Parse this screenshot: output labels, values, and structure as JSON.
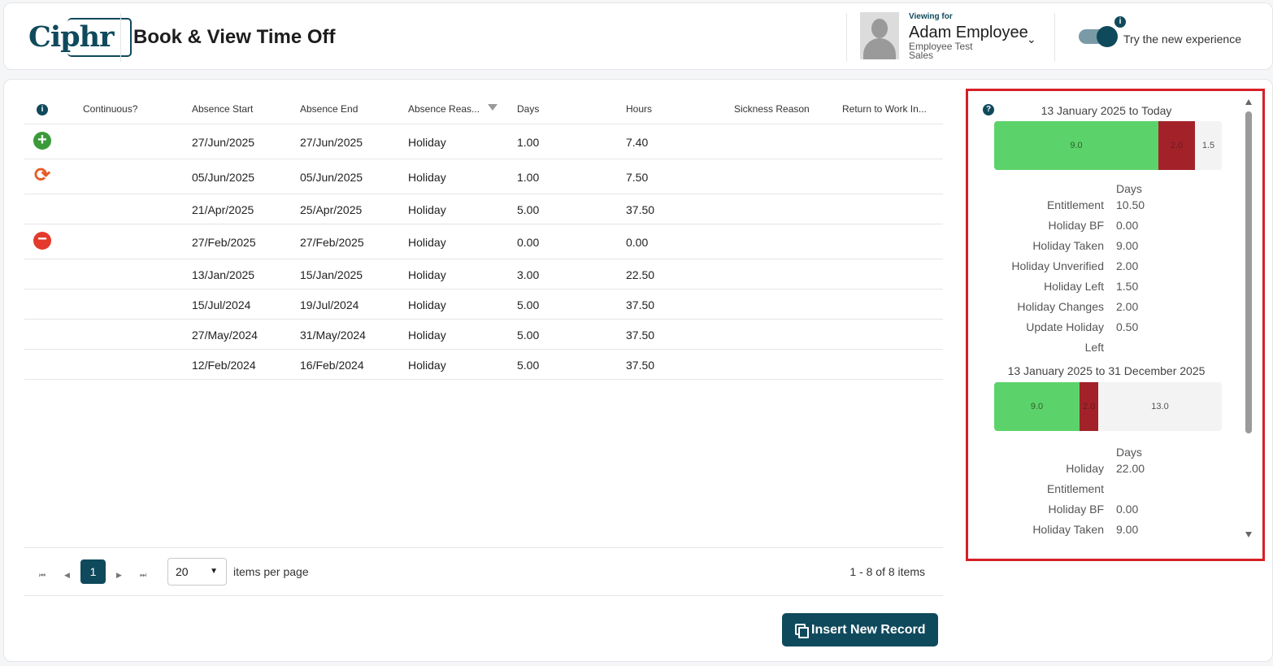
{
  "header": {
    "logo_text": "Ciphr",
    "page_title": "Book & View Time Off",
    "viewing_label": "Viewing for",
    "employee_name": "Adam Employee",
    "employee_sub1": "Employee Test",
    "employee_sub2": "Sales",
    "toggle_label": "Try the new experience",
    "toggle_on": true
  },
  "table": {
    "columns": [
      "Continuous?",
      "Absence Start",
      "Absence End",
      "Absence Reas...",
      "Days",
      "Hours",
      "Sickness Reason",
      "Return to Work In..."
    ],
    "rows": [
      {
        "status_icon": "add-circle-icon",
        "continuous": "",
        "start": "27/Jun/2025",
        "end": "27/Jun/2025",
        "reason": "Holiday",
        "days": "1.00",
        "hours": "7.40",
        "sickness": "",
        "rtw": ""
      },
      {
        "status_icon": "sync-icon",
        "continuous": "",
        "start": "05/Jun/2025",
        "end": "05/Jun/2025",
        "reason": "Holiday",
        "days": "1.00",
        "hours": "7.50",
        "sickness": "",
        "rtw": ""
      },
      {
        "status_icon": "",
        "continuous": "",
        "start": "21/Apr/2025",
        "end": "25/Apr/2025",
        "reason": "Holiday",
        "days": "5.00",
        "hours": "37.50",
        "sickness": "",
        "rtw": ""
      },
      {
        "status_icon": "remove-circle-icon",
        "continuous": "",
        "start": "27/Feb/2025",
        "end": "27/Feb/2025",
        "reason": "Holiday",
        "days": "0.00",
        "hours": "0.00",
        "sickness": "",
        "rtw": ""
      },
      {
        "status_icon": "",
        "continuous": "",
        "start": "13/Jan/2025",
        "end": "15/Jan/2025",
        "reason": "Holiday",
        "days": "3.00",
        "hours": "22.50",
        "sickness": "",
        "rtw": ""
      },
      {
        "status_icon": "",
        "continuous": "",
        "start": "15/Jul/2024",
        "end": "19/Jul/2024",
        "reason": "Holiday",
        "days": "5.00",
        "hours": "37.50",
        "sickness": "",
        "rtw": ""
      },
      {
        "status_icon": "",
        "continuous": "",
        "start": "27/May/2024",
        "end": "31/May/2024",
        "reason": "Holiday",
        "days": "5.00",
        "hours": "37.50",
        "sickness": "",
        "rtw": ""
      },
      {
        "status_icon": "",
        "continuous": "",
        "start": "12/Feb/2024",
        "end": "16/Feb/2024",
        "reason": "Holiday",
        "days": "5.00",
        "hours": "37.50",
        "sickness": "",
        "rtw": ""
      }
    ]
  },
  "pager": {
    "current_page": "1",
    "page_size": "20",
    "page_size_label": "items per page",
    "info": "1 - 8 of 8 items"
  },
  "insert_button_label": "Insert New Record",
  "summary": {
    "period1": {
      "title": "13 January 2025 to Today",
      "bar": [
        {
          "value": 9.0,
          "label": "9.0",
          "color": "#5cd36a"
        },
        {
          "value": 2.0,
          "label": "2.0",
          "color": "#a3222a"
        },
        {
          "value": 1.5,
          "label": "1.5",
          "color": "#f3f3f3"
        }
      ],
      "units_header": "Days",
      "stats": [
        {
          "key": "Entitlement",
          "value": "10.50"
        },
        {
          "key": "Holiday BF",
          "value": "0.00"
        },
        {
          "key": "Holiday Taken",
          "value": "9.00"
        },
        {
          "key": "Holiday Unverified",
          "value": "2.00"
        },
        {
          "key": "Holiday Left",
          "value": "1.50"
        },
        {
          "key": "Holiday Changes",
          "value": "2.00"
        },
        {
          "key": "Update Holiday",
          "value": "0.50"
        },
        {
          "key": "Left",
          "value": ""
        }
      ]
    },
    "period2": {
      "title": "13 January 2025 to 31 December 2025",
      "bar": [
        {
          "value": 9.0,
          "label": "9.0",
          "color": "#5cd36a"
        },
        {
          "value": 2.0,
          "label": "2.0",
          "color": "#a3222a"
        },
        {
          "value": 13.0,
          "label": "13.0",
          "color": "#f3f3f3"
        }
      ],
      "units_header": "Days",
      "stats": [
        {
          "key": "Holiday",
          "value": "22.00"
        },
        {
          "key": "Entitlement",
          "value": ""
        },
        {
          "key": "Holiday BF",
          "value": "0.00"
        },
        {
          "key": "Holiday Taken",
          "value": "9.00"
        }
      ]
    }
  }
}
